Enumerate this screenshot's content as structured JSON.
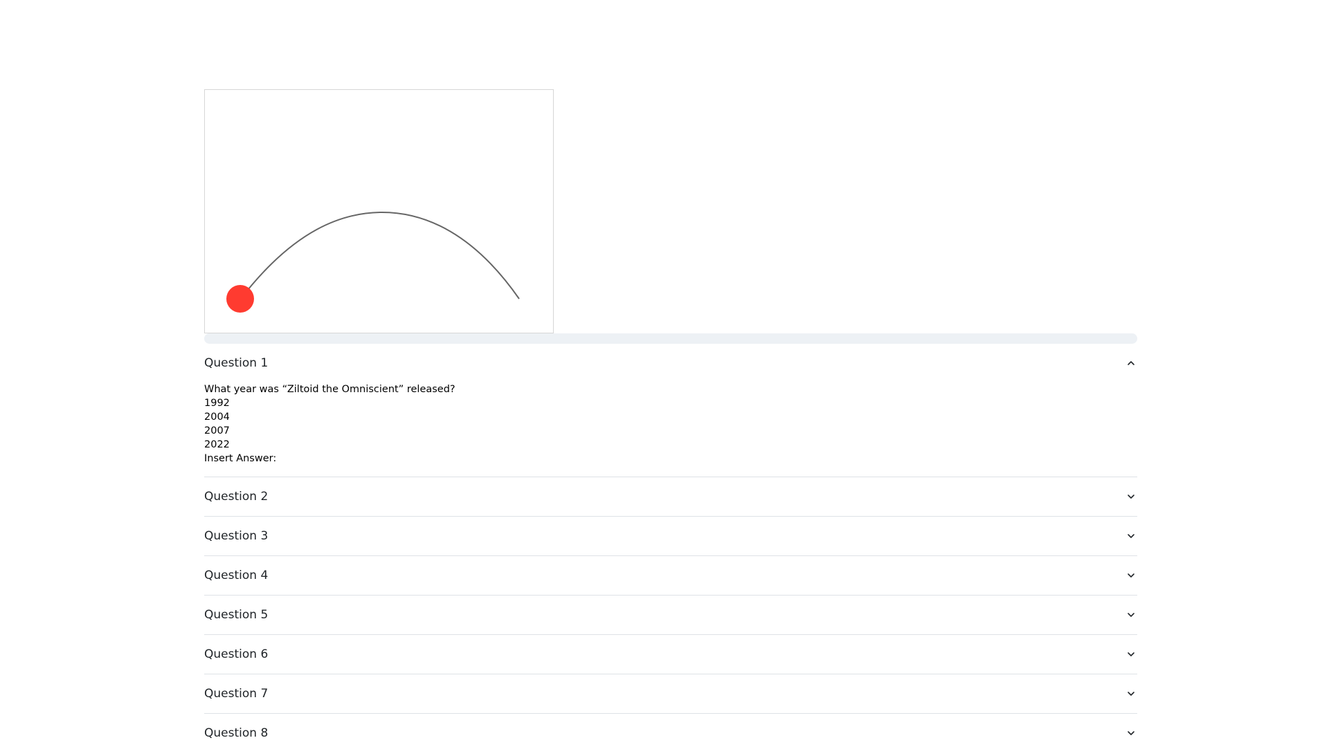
{
  "animation": {
    "ball_color": "#ff3b30",
    "path_color": "#666666"
  },
  "progress": {
    "value": 0
  },
  "questions": [
    {
      "title": "Question 1",
      "expanded": true,
      "prompt": "What year was “Ziltoid the Omniscient” released?",
      "options": [
        "1992",
        "2004",
        "2007",
        "2022"
      ],
      "answer_label": "Insert Answer:",
      "icon": "chevron-up-icon"
    },
    {
      "title": "Question 2",
      "expanded": false,
      "icon": "chevron-down-icon"
    },
    {
      "title": "Question 3",
      "expanded": false,
      "icon": "chevron-down-icon"
    },
    {
      "title": "Question 4",
      "expanded": false,
      "icon": "chevron-down-icon"
    },
    {
      "title": "Question 5",
      "expanded": false,
      "icon": "chevron-down-icon"
    },
    {
      "title": "Question 6",
      "expanded": false,
      "icon": "chevron-down-icon"
    },
    {
      "title": "Question 7",
      "expanded": false,
      "icon": "chevron-down-icon"
    },
    {
      "title": "Question 8",
      "expanded": false,
      "icon": "chevron-down-icon"
    }
  ]
}
